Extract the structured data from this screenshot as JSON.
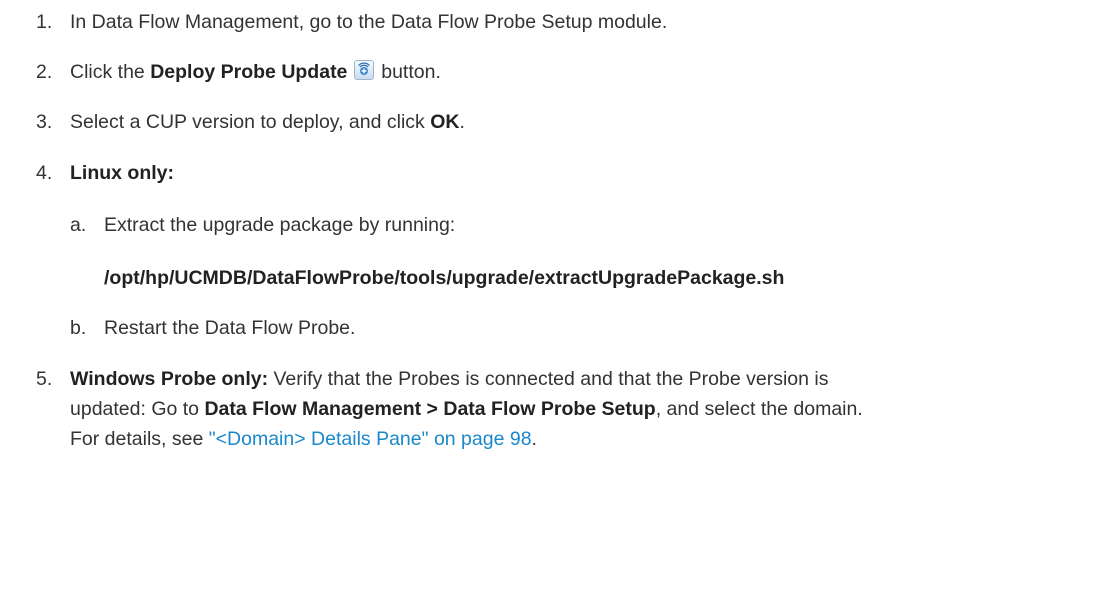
{
  "steps": [
    {
      "num": "1.",
      "text": "In Data Flow Management, go to the Data Flow Probe Setup module."
    },
    {
      "num": "2.",
      "pre": "Click the ",
      "bold": "Deploy Probe Update",
      "post": " button.",
      "icon": "deploy-probe-update-icon"
    },
    {
      "num": "3.",
      "pre": "Select a CUP version to deploy, and click ",
      "bold": "OK",
      "post": "."
    },
    {
      "num": "4.",
      "bold": "Linux only:"
    },
    {
      "num": "5.",
      "bold": "Windows Probe only:",
      "line1": " Verify that the Probes is connected and that the Probe version is",
      "line2_pre": "updated: Go to ",
      "line2_bold": "Data Flow Management > Data Flow Probe Setup",
      "line2_post": ", and select the domain.",
      "line3_pre": "For details, see ",
      "link": "\"<Domain> Details Pane\" on page 98",
      "line3_post": "."
    }
  ],
  "substeps": [
    {
      "letter": "a.",
      "text": "Extract the upgrade package by running:"
    },
    {
      "letter": "b.",
      "text": "Restart the Data Flow Probe."
    }
  ],
  "command": "/opt/hp/UCMDB/DataFlowProbe/tools/upgrade/extractUpgradePackage.sh",
  "colors": {
    "text": "#333333",
    "link": "#1a88c9"
  }
}
